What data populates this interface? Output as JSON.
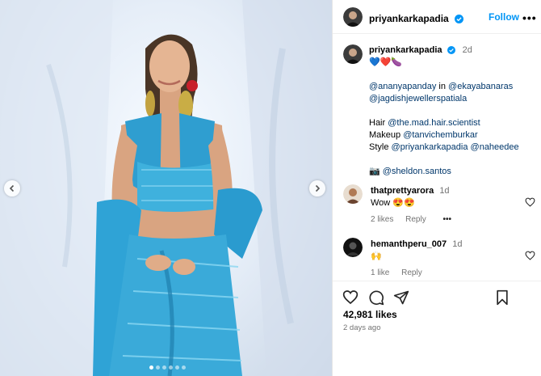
{
  "post": {
    "author": "priyankarkapadia",
    "follow_label": "Follow",
    "more_label": "•••",
    "caption": {
      "username": "priyankarkapadia",
      "time": "2d",
      "emojis": "💙❤️🍆",
      "line1_mention1": "@ananyapanday",
      "line1_mid": " in ",
      "line1_mention2": "@ekayabanaras",
      "line2_mention": "@jagdishjewellerspatiala",
      "hair_label": "Hair ",
      "hair_mention": "@the.mad.hair.scientist",
      "makeup_label": "Makeup ",
      "makeup_mention": "@tanvichemburkar",
      "style_label": "Style ",
      "style_mention1": "@priyankarkapadia",
      "style_mention2": "@naheedee",
      "photo_emoji": "📷 ",
      "photo_mention": "@sheldon.santos"
    },
    "comments": [
      {
        "username": "thatprettyarora",
        "time": "1d",
        "text": "Wow 😍😍",
        "likes": "2 likes",
        "reply": "Reply",
        "more": "•••"
      },
      {
        "username": "hemanthperu_007",
        "time": "1d",
        "text": "🙌",
        "likes": "1 like",
        "reply": "Reply"
      }
    ],
    "likes_count": "42,981 likes",
    "posted_ago": "2 days ago"
  },
  "carousel": {
    "slide_count": 6,
    "active_index": 0
  },
  "icons": {
    "prev": "chevron-left-icon",
    "next": "chevron-right-icon",
    "verified": "verified-badge-icon",
    "like": "heart-icon",
    "comment": "comment-icon",
    "share": "send-icon",
    "save": "bookmark-icon"
  },
  "colors": {
    "accent": "#0095f6",
    "link": "#00376b",
    "verified": "#0095f6",
    "muted": "#737373"
  }
}
